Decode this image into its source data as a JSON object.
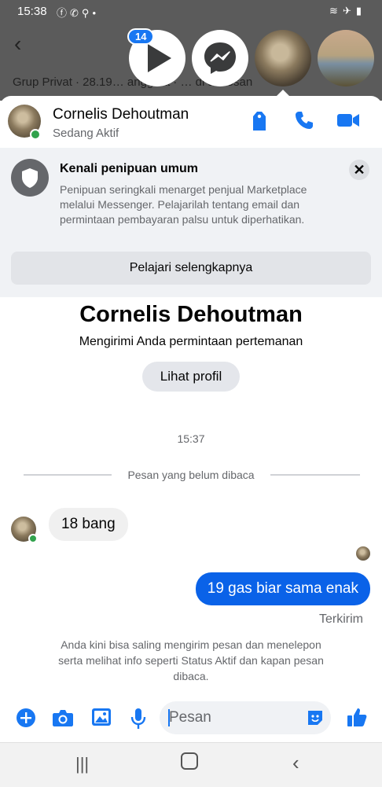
{
  "status_bar": {
    "time": "15:38",
    "left_icons": [
      "facebook-icon",
      "whatsapp-icon",
      "vpn-icon",
      "dot-icon"
    ],
    "right_icons": [
      "wifi-icon",
      "airplane-icon",
      "battery-icon"
    ]
  },
  "background": {
    "title": "",
    "subtitle": "Grup Privat · 28.19… anggota · … di akdosan"
  },
  "chat_heads": {
    "badge": "14"
  },
  "chat": {
    "contact_name": "Cornelis Dehoutman",
    "active_status": "Sedang Aktif",
    "header_icons": [
      "shop-tag-icon",
      "phone-icon",
      "video-camera-icon"
    ]
  },
  "warning": {
    "title": "Kenali penipuan umum",
    "body": "Penipuan seringkali menarget penjual Marketplace melalui Messenger. Pelajarilah tentang email dan permintaan pembayaran palsu untuk diperhatikan.",
    "close": "✕",
    "button": "Pelajari selengkapnya"
  },
  "thread": {
    "profile_name": "Cornelis Dehoutman",
    "friend_request": "Mengirimi Anda permintaan pertemanan",
    "view_profile": "Lihat profil",
    "time": "15:37",
    "unread_label": "Pesan yang belum dibaca",
    "messages": [
      {
        "from": "Cornelis Dehoutman",
        "text": "18 bang"
      },
      {
        "from": "me",
        "text": "19 gas biar sama enak"
      }
    ],
    "delivered": "Terkirim",
    "info": "Anda kini bisa saling mengirim pesan dan menelepon serta melihat info seperti Status Aktif dan kapan pesan dibaca."
  },
  "composer": {
    "placeholder": "Pesan",
    "icons": [
      "plus-icon",
      "camera-icon",
      "gallery-icon",
      "microphone-icon",
      "sticker-icon",
      "like-icon"
    ]
  },
  "colors": {
    "accent": "#0a62e8",
    "online": "#31a24c"
  }
}
